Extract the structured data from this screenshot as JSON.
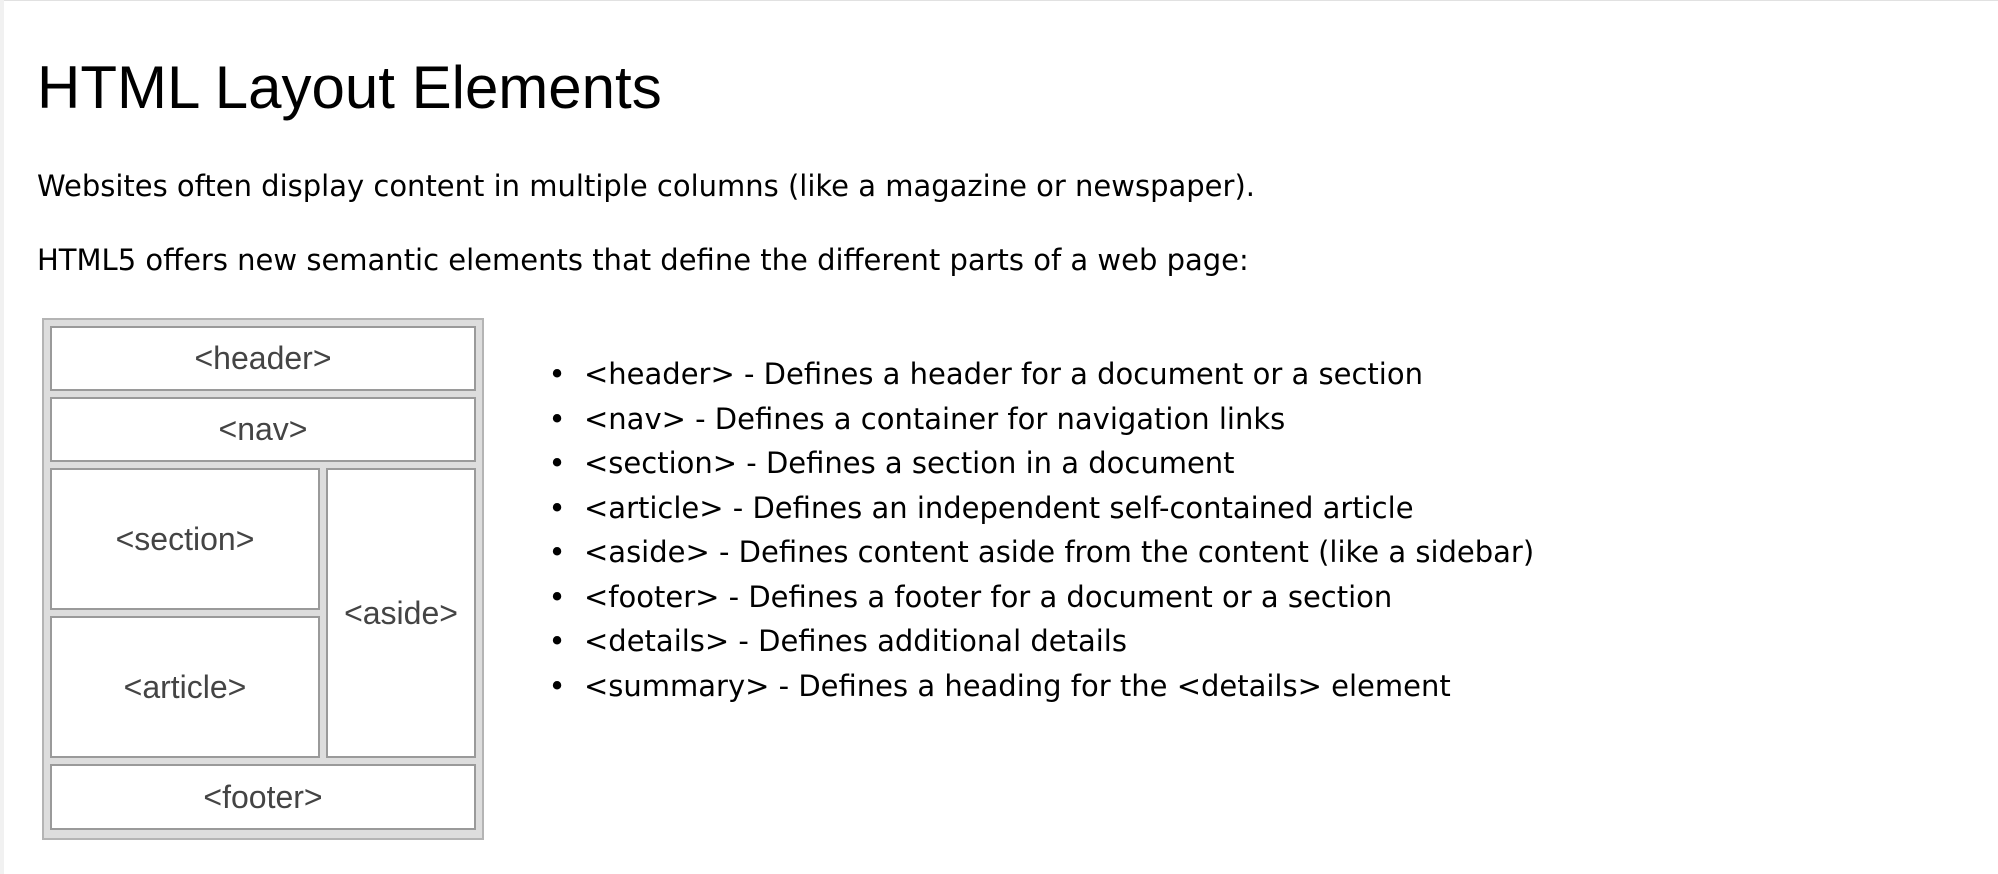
{
  "page": {
    "title": "HTML Layout Elements",
    "intro": [
      "Websites often display content in multiple columns (like a magazine or newspaper).",
      "HTML5 offers new semantic elements that define the different parts of a web page:"
    ]
  },
  "diagram": {
    "header": "<header>",
    "nav": "<nav>",
    "section": "<section>",
    "article": "<article>",
    "aside": "<aside>",
    "footer": "<footer>"
  },
  "elements": [
    "<header> - Defines a header for a document or a section",
    "<nav> - Defines a container for navigation links",
    "<section> - Defines a section in a document",
    "<article> - Defines an independent self-contained article",
    "<aside> - Defines content aside from the content (like a sidebar)",
    "<footer> - Defines a footer for a document or a section",
    "<details> - Defines additional details",
    "<summary> - Defines a heading for the <details> element"
  ]
}
